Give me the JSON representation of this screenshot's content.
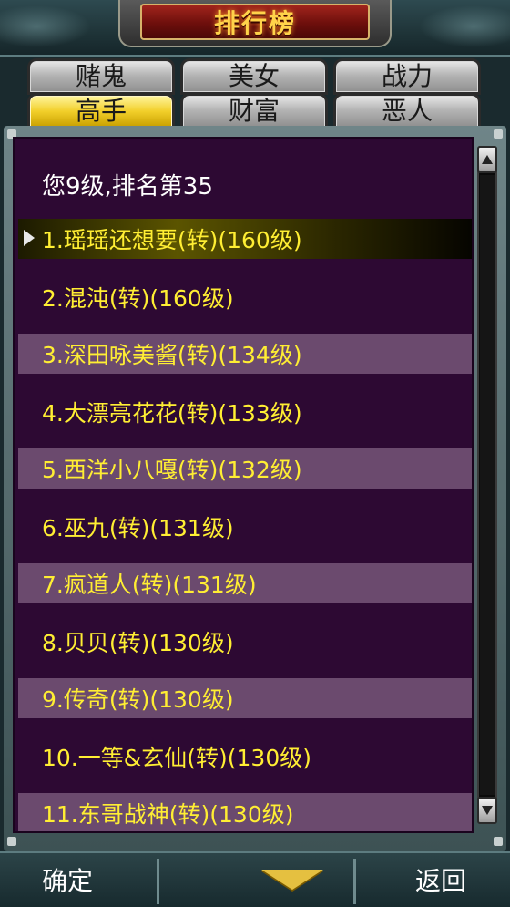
{
  "header": {
    "title": "排行榜"
  },
  "tabs": [
    {
      "label": "赌鬼",
      "active": false
    },
    {
      "label": "美女",
      "active": false
    },
    {
      "label": "战力",
      "active": false
    },
    {
      "label": "高手",
      "active": true
    },
    {
      "label": "财富",
      "active": false
    },
    {
      "label": "恶人",
      "active": false
    }
  ],
  "ranking": {
    "my_rank": "您9级,排名第35",
    "rows": [
      "1.瑶瑶还想要(转)(160级)",
      "2.混沌(转)(160级)",
      "3.深田咏美酱(转)(134级)",
      "4.大漂亮花花(转)(133级)",
      "5.西洋小八嘎(转)(132级)",
      "6.巫九(转)(131级)",
      "7.疯道人(转)(131级)",
      "8.贝贝(转)(130级)",
      "9.传奇(转)(130级)",
      "10.一等&玄仙(转)(130级)",
      "11.东哥战神(转)(130级)"
    ]
  },
  "footer": {
    "confirm": "确定",
    "back": "返回"
  },
  "icons": {
    "scroll_up": "chevron-up-icon",
    "scroll_down": "chevron-down-icon",
    "menu_arrow": "triangle-down-icon"
  },
  "colors": {
    "row_text": "#ffee33",
    "panel_bg": "#2d0933",
    "stripe": "#6b4a6e",
    "active_tab": "#f2cf2a"
  }
}
